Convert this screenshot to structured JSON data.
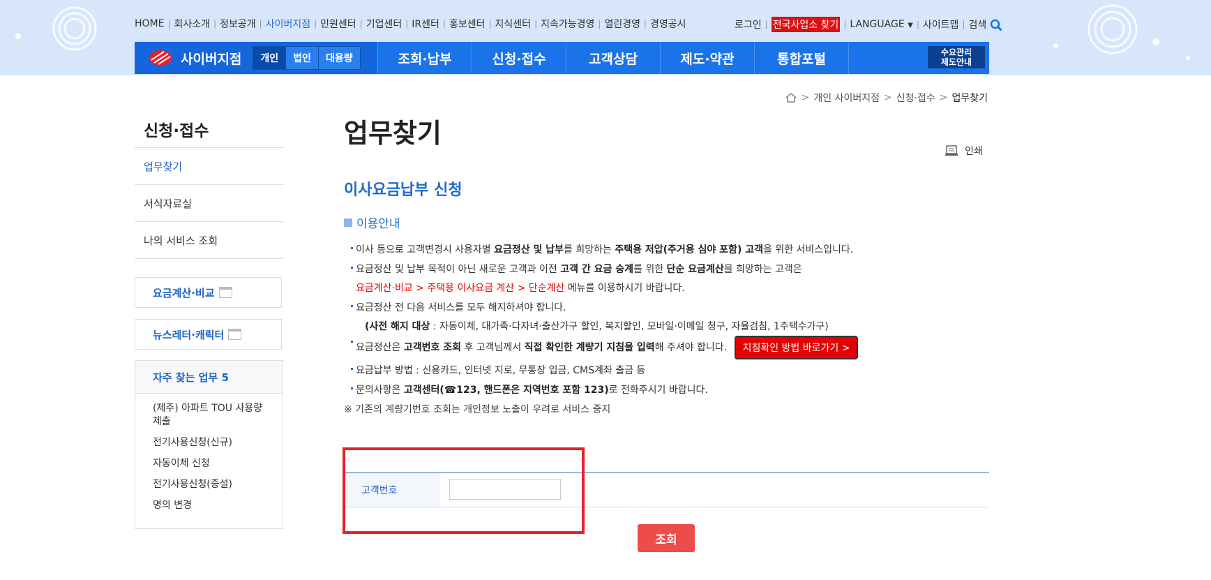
{
  "util_nav": {
    "left": [
      "HOME",
      "회사소개",
      "정보공개",
      "사이버지점",
      "민원센터",
      "기업센터",
      "IR센터",
      "홍보센터",
      "지식센터",
      "지속가능경영",
      "열린경영",
      "경영공시"
    ],
    "active": "사이버지점",
    "right": {
      "login": "로그인",
      "find_office": "전국사업소 찾기",
      "language": "LANGUAGE",
      "sitemap": "사이트맵",
      "search": "검색"
    }
  },
  "gnb": {
    "brand": "사이버지점",
    "segments": [
      "개인",
      "법인",
      "대용량"
    ],
    "active_segment": "개인",
    "menu": [
      "조회·납부",
      "신청·접수",
      "고객상담",
      "제도·약관",
      "통합포털"
    ],
    "demand_line1": "수요관리",
    "demand_line2": "제도안내"
  },
  "breadcrumb": [
    "개인 사이버지점",
    "신청·접수",
    "업무찾기"
  ],
  "sidebar": {
    "title": "신청·접수",
    "items": [
      "업무찾기",
      "서식자료실",
      "나의 서비스 조회"
    ],
    "active": "업무찾기",
    "boxes": [
      "요금계산·비교",
      "뉴스레터·캐릭터"
    ],
    "frequent_title": "자주 찾는 업무 5",
    "frequent": [
      "(제주) 아파트 TOU 사용량 제출",
      "전기사용신청(신규)",
      "자동이체 신청",
      "전기사용신청(증설)",
      "명의 변경"
    ]
  },
  "content": {
    "title": "업무찾기",
    "print": "인쇄",
    "subtitle": "이사요금납부 신청",
    "guide_title": "이용안내",
    "bullet1": {
      "a": "이사 등으로 고객변경시 사용자별 ",
      "b": "요금정산 및 납부",
      "c": "를 희망하는 ",
      "d": "주택용 저압(주거용 심야 포함) 고객",
      "e": "을 위한 서비스입니다."
    },
    "bullet2": {
      "a": "요금정산 및 납부 목적이 아닌 새로운 고객과 이전 ",
      "b": "고객 간 요금 승계",
      "c": "를 위한 ",
      "d": "단순 요금계산",
      "e": "을 희망하는 고객은"
    },
    "bullet2_line2": {
      "red": "요금계산·비교 > 주택용 이사요금 계산 > 단순계산",
      "rest": " 메뉴를 이용하시기 바랍니다."
    },
    "bullet3": "요금정산 전 다음 서비스를 모두 해지하셔야 합니다.",
    "bullet3_line2": {
      "b": "(사전 해지 대상",
      "rest": " : 자동이체, 대가족·다자녀·출산가구 할인, 복지할인, 모바일·이메일 청구, 자율검침, 1주택수가구)"
    },
    "bullet4": {
      "a": "요금정산은 ",
      "b": "고객번호 조회",
      "c": " 후 고객님께서 ",
      "d": "직접 확인한 계량기 지침을 입력",
      "e": "해 주셔야 합니다."
    },
    "bullet4_button": "지침확인 방법 바로가기 >",
    "bullet5": "요금납부 방법 : 신용카드, 인터넷 지로, 무통장 입금, CMS계좌 출금 등",
    "bullet6": {
      "a": "문의사항은 ",
      "b": "고객센터(☎123, 핸드폰은 지역번호 포함 123)",
      "c": "로 전화주시기 바랍니다."
    },
    "note": "※ 기존의 계량기번호 조회는 개인정보 노출이 우려로 서비스 중지",
    "form_label": "고객번호",
    "search_button": "조회"
  },
  "colors": {
    "primary": "#1a73e8",
    "accent_red": "#e60000",
    "highlight_box": "#e8202a",
    "top_bg": "#d7e6fb"
  }
}
